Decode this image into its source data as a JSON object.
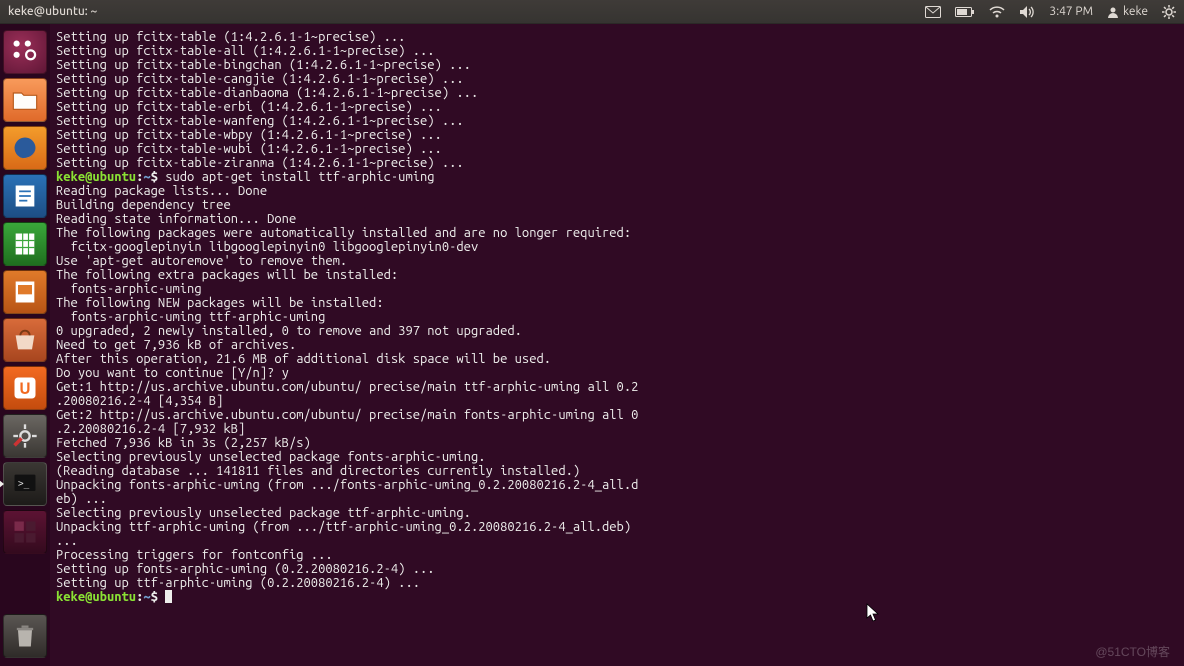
{
  "topbar": {
    "title": "keke@ubuntu: ~",
    "time": "3:47 PM",
    "username": "keke"
  },
  "launcher": {
    "items": [
      {
        "name": "dash",
        "label": "Dash"
      },
      {
        "name": "files",
        "label": "Files"
      },
      {
        "name": "firefox",
        "label": "Firefox"
      },
      {
        "name": "writer",
        "label": "LibreOffice Writer"
      },
      {
        "name": "calc",
        "label": "LibreOffice Calc"
      },
      {
        "name": "impress",
        "label": "LibreOffice Impress"
      },
      {
        "name": "usc",
        "label": "Ubuntu Software Center"
      },
      {
        "name": "uone",
        "label": "Ubuntu One"
      },
      {
        "name": "settings",
        "label": "System Settings"
      },
      {
        "name": "terminal",
        "label": "Terminal"
      },
      {
        "name": "workspace",
        "label": "Workspace Switcher"
      },
      {
        "name": "trash",
        "label": "Trash"
      }
    ]
  },
  "prompt": {
    "user_host": "keke@ubuntu",
    "colon": ":",
    "path": "~",
    "sigil": "$"
  },
  "terminal": {
    "lines": [
      "Setting up fcitx-table (1:4.2.6.1-1~precise) ...",
      "Setting up fcitx-table-all (1:4.2.6.1-1~precise) ...",
      "Setting up fcitx-table-bingchan (1:4.2.6.1-1~precise) ...",
      "Setting up fcitx-table-cangjie (1:4.2.6.1-1~precise) ...",
      "Setting up fcitx-table-dianbaoma (1:4.2.6.1-1~precise) ...",
      "Setting up fcitx-table-erbi (1:4.2.6.1-1~precise) ...",
      "Setting up fcitx-table-wanfeng (1:4.2.6.1-1~precise) ...",
      "Setting up fcitx-table-wbpy (1:4.2.6.1-1~precise) ...",
      "Setting up fcitx-table-wubi (1:4.2.6.1-1~precise) ...",
      "Setting up fcitx-table-ziranma (1:4.2.6.1-1~precise) ..."
    ],
    "cmd1": " sudo apt-get install ttf-arphic-uming",
    "lines2": [
      "Reading package lists... Done",
      "Building dependency tree       ",
      "Reading state information... Done",
      "The following packages were automatically installed and are no longer required:",
      "  fcitx-googlepinyin libgooglepinyin0 libgooglepinyin0-dev",
      "Use 'apt-get autoremove' to remove them.",
      "The following extra packages will be installed:",
      "  fonts-arphic-uming",
      "The following NEW packages will be installed:",
      "  fonts-arphic-uming ttf-arphic-uming",
      "0 upgraded, 2 newly installed, 0 to remove and 397 not upgraded.",
      "Need to get 7,936 kB of archives.",
      "After this operation, 21.6 MB of additional disk space will be used.",
      "Do you want to continue [Y/n]? y",
      "Get:1 http://us.archive.ubuntu.com/ubuntu/ precise/main ttf-arphic-uming all 0.2",
      ".20080216.2-4 [4,354 B]",
      "Get:2 http://us.archive.ubuntu.com/ubuntu/ precise/main fonts-arphic-uming all 0",
      ".2.20080216.2-4 [7,932 kB]",
      "Fetched 7,936 kB in 3s (2,257 kB/s)",
      "Selecting previously unselected package fonts-arphic-uming.",
      "(Reading database ... 141811 files and directories currently installed.)",
      "Unpacking fonts-arphic-uming (from .../fonts-arphic-uming_0.2.20080216.2-4_all.d",
      "eb) ...",
      "Selecting previously unselected package ttf-arphic-uming.",
      "Unpacking ttf-arphic-uming (from .../ttf-arphic-uming_0.2.20080216.2-4_all.deb) ",
      "...",
      "Processing triggers for fontconfig ...",
      "Setting up fonts-arphic-uming (0.2.20080216.2-4) ...",
      "Setting up ttf-arphic-uming (0.2.20080216.2-4) ..."
    ]
  },
  "watermark": "@51CTO博客"
}
